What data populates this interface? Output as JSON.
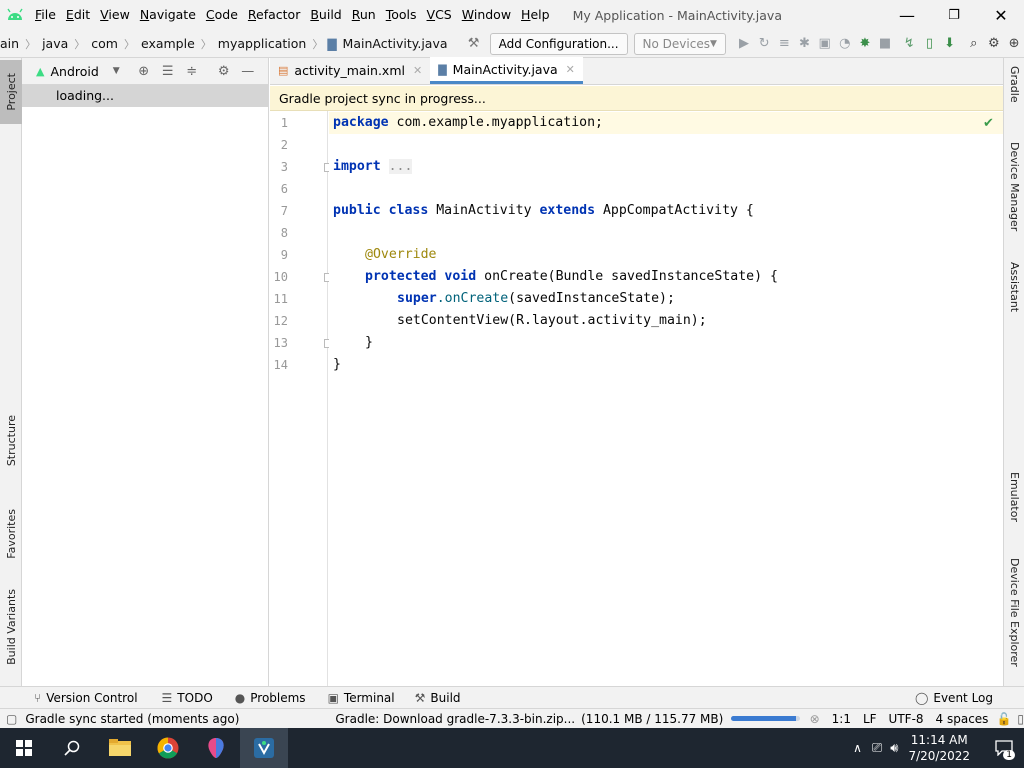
{
  "window": {
    "title": "My Application - MainActivity.java",
    "menu": [
      {
        "label": "File",
        "u": "F",
        "rest": "ile"
      },
      {
        "label": "Edit",
        "u": "E",
        "rest": "dit"
      },
      {
        "label": "View",
        "u": "V",
        "rest": "iew"
      },
      {
        "label": "Navigate",
        "u": "N",
        "rest": "avigate"
      },
      {
        "label": "Code",
        "u": "C",
        "rest": "ode"
      },
      {
        "label": "Refactor",
        "u": "R",
        "rest": "efactor"
      },
      {
        "label": "Build",
        "u": "B",
        "rest": "uild"
      },
      {
        "label": "Run",
        "u": "R",
        "rest": "un"
      },
      {
        "label": "Tools",
        "u": "T",
        "rest": "ools"
      },
      {
        "label": "VCS",
        "u": "V",
        "rest": "CS"
      },
      {
        "label": "Window",
        "u": "W",
        "rest": "indow"
      },
      {
        "label": "Help",
        "u": "H",
        "rest": "elp"
      }
    ],
    "controls": {
      "minimize": "—",
      "maximize": "❐",
      "close": "✕"
    }
  },
  "navbar": {
    "breadcrumbs": [
      "ain",
      "java",
      "com",
      "example",
      "myapplication",
      "MainActivity.java"
    ],
    "add_config": "Add Configuration...",
    "device": "No Devices"
  },
  "project_panel": {
    "view_mode": "Android",
    "loading_text": "loading..."
  },
  "left_tabs": {
    "project": "Project",
    "structure": "Structure",
    "favorites": "Favorites",
    "build_variants": "Build Variants"
  },
  "right_tabs": {
    "gradle": "Gradle",
    "device_manager": "Device Manager",
    "assistant": "Assistant",
    "emulator": "Emulator",
    "device_file_explorer": "Device File Explorer"
  },
  "editor": {
    "tabs": [
      {
        "label": "activity_main.xml",
        "active": false
      },
      {
        "label": "MainActivity.java",
        "active": true
      }
    ],
    "banner": "Gradle project sync in progress...",
    "line_numbers": [
      "1",
      "2",
      "3",
      "6",
      "7",
      "8",
      "9",
      "10",
      "11",
      "12",
      "13",
      "14"
    ],
    "code": {
      "l1_kw": "package",
      "l1_rest": " com.example.myapplication;",
      "l3_kw": "import",
      "l3_dots": "...",
      "l7_kw1": "public",
      "l7_kw2": "class",
      "l7_name": " MainActivity ",
      "l7_kw3": "extends",
      "l7_rest": " AppCompatActivity {",
      "l9_ann": "@Override",
      "l10_kw1": "protected",
      "l10_kw2": "void",
      "l10_rest": " onCreate(Bundle savedInstanceState) {",
      "l11_kw": "super",
      "l11_call": ".onCreate",
      "l11_rest": "(savedInstanceState);",
      "l12_rest": "setContentView(R.layout.activity_main);",
      "l13": "}",
      "l14": "}"
    }
  },
  "tool_tabs": {
    "version_control": "Version Control",
    "todo": "TODO",
    "problems": "Problems",
    "terminal": "Terminal",
    "build": "Build",
    "event_log": "Event Log"
  },
  "status": {
    "message": "Gradle sync started (moments ago)",
    "download": "Gradle: Download gradle-7.3.3-bin.zip...",
    "download_size": "(110.1 MB / 115.77 MB)",
    "download_progress": 0.951,
    "caret": "1:1",
    "line_sep": "LF",
    "encoding": "UTF-8",
    "indent": "4 spaces"
  },
  "taskbar": {
    "time": "11:14 AM",
    "date": "7/20/2022",
    "notifications": "1"
  },
  "colors": {
    "keyword": "#0033b3",
    "annotation": "#9e880d",
    "accent": "#4a88c7",
    "banner": "#fcf5d6",
    "android_green": "#3ddc84"
  }
}
